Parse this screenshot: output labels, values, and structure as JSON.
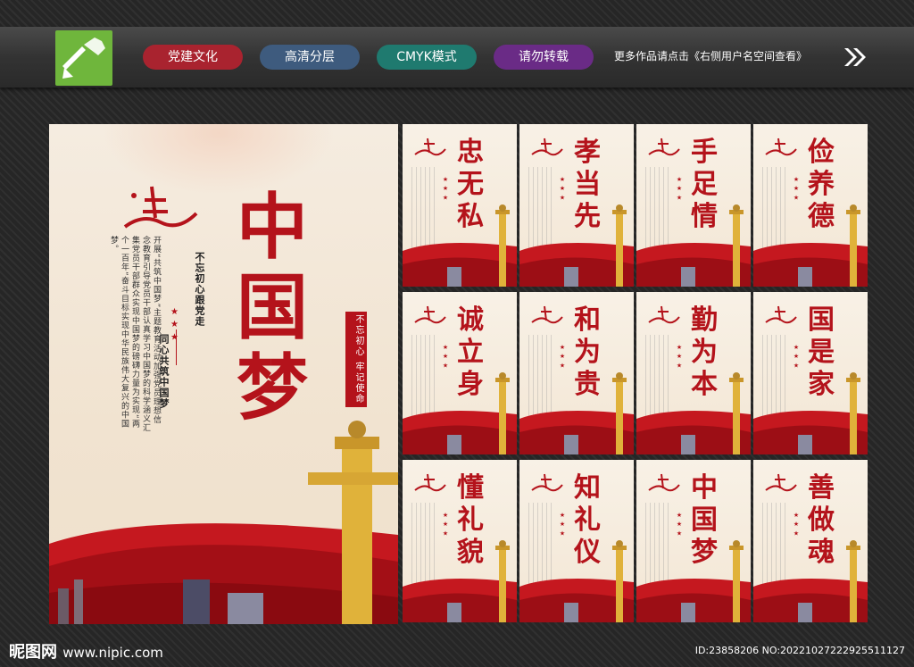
{
  "header": {
    "pills": [
      "党建文化",
      "高清分层",
      "CMYK模式",
      "请勿转载"
    ],
    "more_text": "更多作品请点击《右侧用户名空间查看》"
  },
  "main_poster": {
    "title": [
      "中",
      "国",
      "梦"
    ],
    "slogan_1": "不忘初心跟党走",
    "slogan_2": "同心共筑中国梦",
    "body": "开展“共筑中国梦”主题教育活动加强党员理想信念教育引导党员干部认真学习中国梦的科学涵义汇集党员干部群众实现中国梦的磅礴力量为实现“两个一百年”奋斗目标实现中华民族伟大复兴的中国梦。",
    "badge": "不忘初心 牢记使命"
  },
  "cards": [
    {
      "title": "忠无私"
    },
    {
      "title": "孝当先"
    },
    {
      "title": "手足情"
    },
    {
      "title": "俭养德"
    },
    {
      "title": "诚立身"
    },
    {
      "title": "和为贵"
    },
    {
      "title": "勤为本"
    },
    {
      "title": "国是家"
    },
    {
      "title": "懂礼貌"
    },
    {
      "title": "知礼仪"
    },
    {
      "title": "中国梦"
    },
    {
      "title": "善做魂"
    }
  ],
  "footer": {
    "site": "昵图网",
    "url": "www.nipic.com",
    "id_text": "ID:23858206 NO:20221027222925511127"
  },
  "colors": {
    "accent_red": "#b4131b",
    "gold": "#e0b23a",
    "logo_green": "#6fb63c"
  }
}
